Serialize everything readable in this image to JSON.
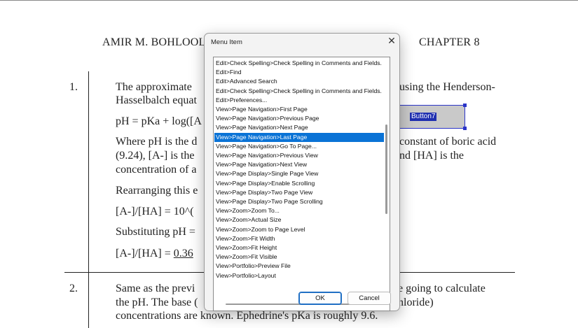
{
  "document": {
    "header_left": "AMIR M. BOHLOOLI",
    "header_right": "CHAPTER 8",
    "q1_number": "1.",
    "q1_line1": "The approximate",
    "q1_line1_tail": "using the Henderson-",
    "q1_line2": "Hasselbalch equat",
    "formula_1": "pH = pKa + log([A",
    "where_1": "Where pH is the d",
    "where_1_tail": "constant of boric acid",
    "where_2": "(9.24), [A-] is the",
    "where_2_tail": "nd [HA] is the",
    "where_3": "concentration of a",
    "rearranging": "Rearranging this e",
    "formula_2": "[A-]/[HA] = 10^(",
    "substituting": "Substituting pH =",
    "result_prefix": "[A-]/[HA] = ",
    "result_value": "0.36",
    "q2_number": "2.",
    "q2_line1": "Same as the previ",
    "q2_line1_tail": "e going to calculate",
    "q2_line2": "the pH. The base (",
    "q2_line2_tail": "hloride)",
    "q2_line3": "concentrations are known. Ephedrine's pKa is roughly 9.6.",
    "form_button_label": "Button7"
  },
  "dialog": {
    "title": "Menu Item",
    "close_glyph": "✕",
    "selected_index": 8,
    "items": [
      "Edit>Check Spelling>Check Spelling in Comments and Fields.",
      "Edit>Find",
      "Edit>Advanced Search",
      "Edit>Check Spelling>Check Spelling in Comments and Fields.",
      "Edit>Preferences...",
      "View>Page Navigation>First Page",
      "View>Page Navigation>Previous Page",
      "View>Page Navigation>Next Page",
      "View>Page Navigation>Last Page",
      "View>Page Navigation>Go To Page...",
      "View>Page Navigation>Previous View",
      "View>Page Navigation>Next View",
      "View>Page Display>Single Page View",
      "View>Page Display>Enable Scrolling",
      "View>Page Display>Two Page View",
      "View>Page Display>Two Page Scrolling",
      "View>Zoom>Zoom To...",
      "View>Zoom>Actual Size",
      "View>Zoom>Zoom to Page Level",
      "View>Zoom>Fit Width",
      "View>Zoom>Fit Height",
      "View>Zoom>Fit Visible",
      "View>Portfolio>Preview File",
      "View>Portfolio>Layout"
    ],
    "ok_label": "OK",
    "cancel_label": "Cancel"
  },
  "colors": {
    "selection": "#0a73d6",
    "form_button_border": "#2a34c8"
  }
}
